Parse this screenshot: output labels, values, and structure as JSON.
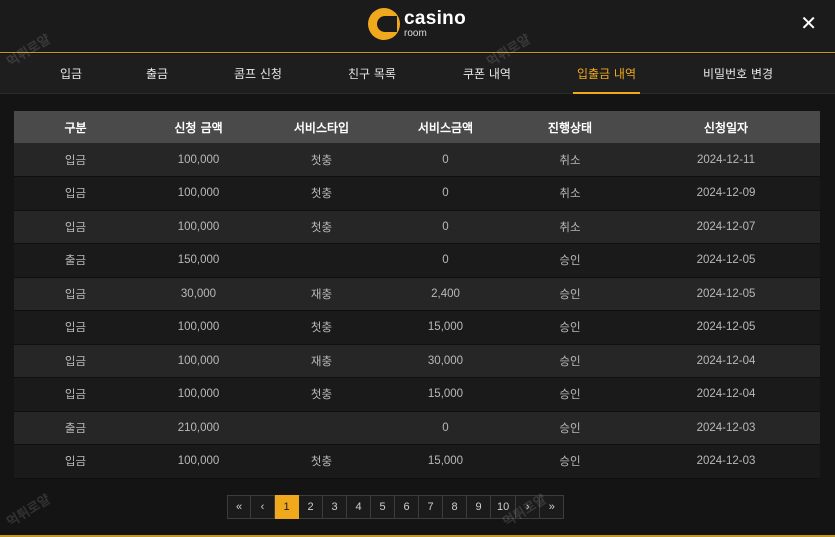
{
  "header": {
    "logo_main": "casino",
    "logo_sub": "room",
    "close_label": "✕"
  },
  "tabs": [
    {
      "label": "입금"
    },
    {
      "label": "출금"
    },
    {
      "label": "콤프 신청"
    },
    {
      "label": "친구 목록"
    },
    {
      "label": "쿠폰 내역"
    },
    {
      "label": "입출금 내역",
      "active": true
    },
    {
      "label": "비밀번호 변경"
    }
  ],
  "table": {
    "headers": [
      "구분",
      "신청 금액",
      "서비스타입",
      "서비스금액",
      "진행상태",
      "신청일자"
    ],
    "rows": [
      [
        "입금",
        "100,000",
        "첫충",
        "0",
        "취소",
        "2024-12-11"
      ],
      [
        "입금",
        "100,000",
        "첫충",
        "0",
        "취소",
        "2024-12-09"
      ],
      [
        "입금",
        "100,000",
        "첫충",
        "0",
        "취소",
        "2024-12-07"
      ],
      [
        "출금",
        "150,000",
        "",
        "0",
        "승인",
        "2024-12-05"
      ],
      [
        "입금",
        "30,000",
        "재충",
        "2,400",
        "승인",
        "2024-12-05"
      ],
      [
        "입금",
        "100,000",
        "첫충",
        "15,000",
        "승인",
        "2024-12-05"
      ],
      [
        "입금",
        "100,000",
        "재충",
        "30,000",
        "승인",
        "2024-12-04"
      ],
      [
        "입금",
        "100,000",
        "첫충",
        "15,000",
        "승인",
        "2024-12-04"
      ],
      [
        "출금",
        "210,000",
        "",
        "0",
        "승인",
        "2024-12-03"
      ],
      [
        "입금",
        "100,000",
        "첫충",
        "15,000",
        "승인",
        "2024-12-03"
      ]
    ]
  },
  "pagination": {
    "first": "«",
    "prev": "‹",
    "pages": [
      "1",
      "2",
      "3",
      "4",
      "5",
      "6",
      "7",
      "8",
      "9",
      "10"
    ],
    "current": "1",
    "next": "›",
    "last": "»"
  },
  "watermark": "먹튀로얄",
  "colors": {
    "accent": "#f0a91c",
    "background": "#141414",
    "header_row": "#4a4a4a"
  }
}
